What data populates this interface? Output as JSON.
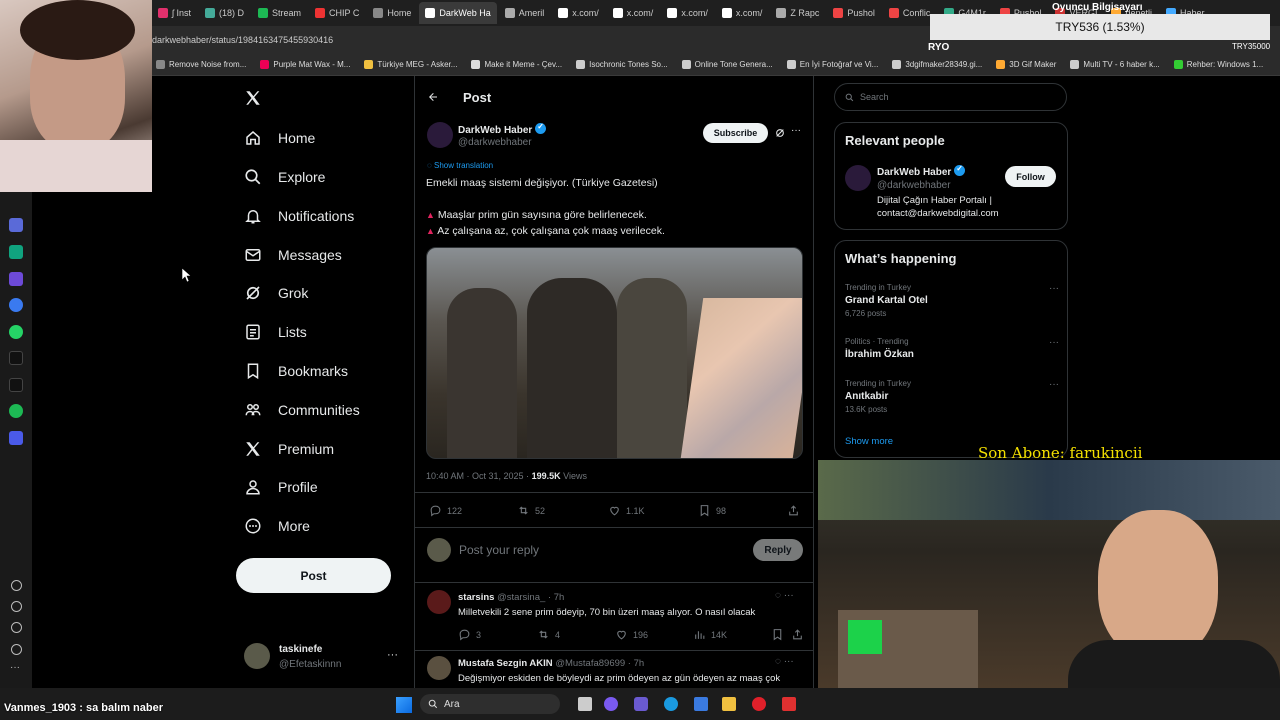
{
  "browser": {
    "tabs": [
      "ʃ Inst",
      "(18) D",
      "Stream",
      "CHIP C",
      "Home",
      "DarkWeb Ha",
      "Ameril",
      "x.com/",
      "x.com/",
      "x.com/",
      "x.com/",
      "Z Rapc",
      "Pushol",
      "Conflic",
      "G4M1r",
      "Pushol",
      "VERGI",
      "denetli",
      "Haber"
    ],
    "active_tab_index": 5,
    "url": "darkwebhaber/status/1984163475455930416",
    "bookmarks": [
      "Remove Noise from...",
      "Purple Mat Wax - M...",
      "Türkiye MEG - Asker...",
      "Make it Meme - Çev...",
      "Isochronic Tones So...",
      "Online Tone Genera...",
      "En İyi Fotoğraf ve Vi...",
      "3dgifmaker28349.gi...",
      "3D Gif Maker",
      "Multi TV - 6 haber k...",
      "Rehber: Windows 1..."
    ]
  },
  "overlay": {
    "ticker": "TRY536 (1.53%)",
    "ticker_small": "TRY35000",
    "ticker_left": "RYO",
    "top_right_text": "Oyuncu Bilgisayarı",
    "last_sub": "Son Abone: farukincii",
    "chat": "Vanmes_1903 : sa balım naber"
  },
  "nav": {
    "items": [
      {
        "label": "Home",
        "icon": "home-icon"
      },
      {
        "label": "Explore",
        "icon": "search-icon"
      },
      {
        "label": "Notifications",
        "icon": "bell-icon"
      },
      {
        "label": "Messages",
        "icon": "mail-icon"
      },
      {
        "label": "Grok",
        "icon": "grok-icon"
      },
      {
        "label": "Lists",
        "icon": "list-icon"
      },
      {
        "label": "Bookmarks",
        "icon": "bookmark-icon"
      },
      {
        "label": "Communities",
        "icon": "communities-icon"
      },
      {
        "label": "Premium",
        "icon": "x-logo-icon"
      },
      {
        "label": "Profile",
        "icon": "person-icon"
      },
      {
        "label": "More",
        "icon": "more-circle-icon"
      }
    ],
    "post_label": "Post",
    "account": {
      "name": "taskinefe",
      "handle": "@Efetaskinnn",
      "more": "···"
    }
  },
  "post": {
    "header_title": "Post",
    "author": {
      "name": "DarkWeb Haber",
      "handle": "@darkwebhaber"
    },
    "subscribe_label": "Subscribe",
    "show_translation": "Show translation",
    "text_line1": "Emekli maaş sistemi değişiyor. (Türkiye Gazetesi)",
    "bullet1": "Maaşlar prim gün sayısına göre belirlenecek.",
    "bullet2": "Az çalışana az, çok çalışana çok maaş verilecek.",
    "timestamp": "10:40 AM · Oct 31, 2025 ·",
    "views_count": "199.5K",
    "views_label": "Views",
    "stats": {
      "replies": "122",
      "reposts": "52",
      "likes": "1.1K",
      "bookmarks": "98"
    },
    "reply_placeholder": "Post your reply",
    "reply_button": "Reply"
  },
  "replies": [
    {
      "name": "starsins",
      "handle": "@starsina_ · 7h",
      "text": "Milletvekili 2 sene prim ödeyip, 70 bin üzeri maaş alıyor. O nasıl olacak",
      "stats": {
        "replies": "3",
        "reposts": "4",
        "likes": "196",
        "views": "14K"
      }
    },
    {
      "name": "Mustafa Sezgin AKIN",
      "handle": "@Mustafa89699 · 7h",
      "text": "Değişmiyor eskiden de böyleydi az prim ödeyen az gün ödeyen az maaş çok"
    }
  ],
  "right": {
    "search_placeholder": "Search",
    "relevant_title": "Relevant people",
    "person": {
      "name": "DarkWeb Haber",
      "handle": "@darkwebhaber",
      "bio": "Dijital Çağın Haber Portalı | contact@darkwebdigital.com",
      "follow_label": "Follow"
    },
    "happening_title": "What’s happening",
    "trends": [
      {
        "context": "Trending in Turkey",
        "title": "Grand Kartal Otel",
        "posts": "6,726 posts"
      },
      {
        "context": "Politics · Trending",
        "title": "İbrahim Özkan",
        "posts": ""
      },
      {
        "context": "Trending in Turkey",
        "title": "Anıtkabir",
        "posts": "13.6K posts"
      }
    ],
    "show_more": "Show more"
  },
  "taskbar": {
    "search_label": "Ara"
  },
  "colors": {
    "accent": "#1d9bf0",
    "bg": "#000000",
    "border": "#2f3336",
    "muted": "#71767b"
  }
}
